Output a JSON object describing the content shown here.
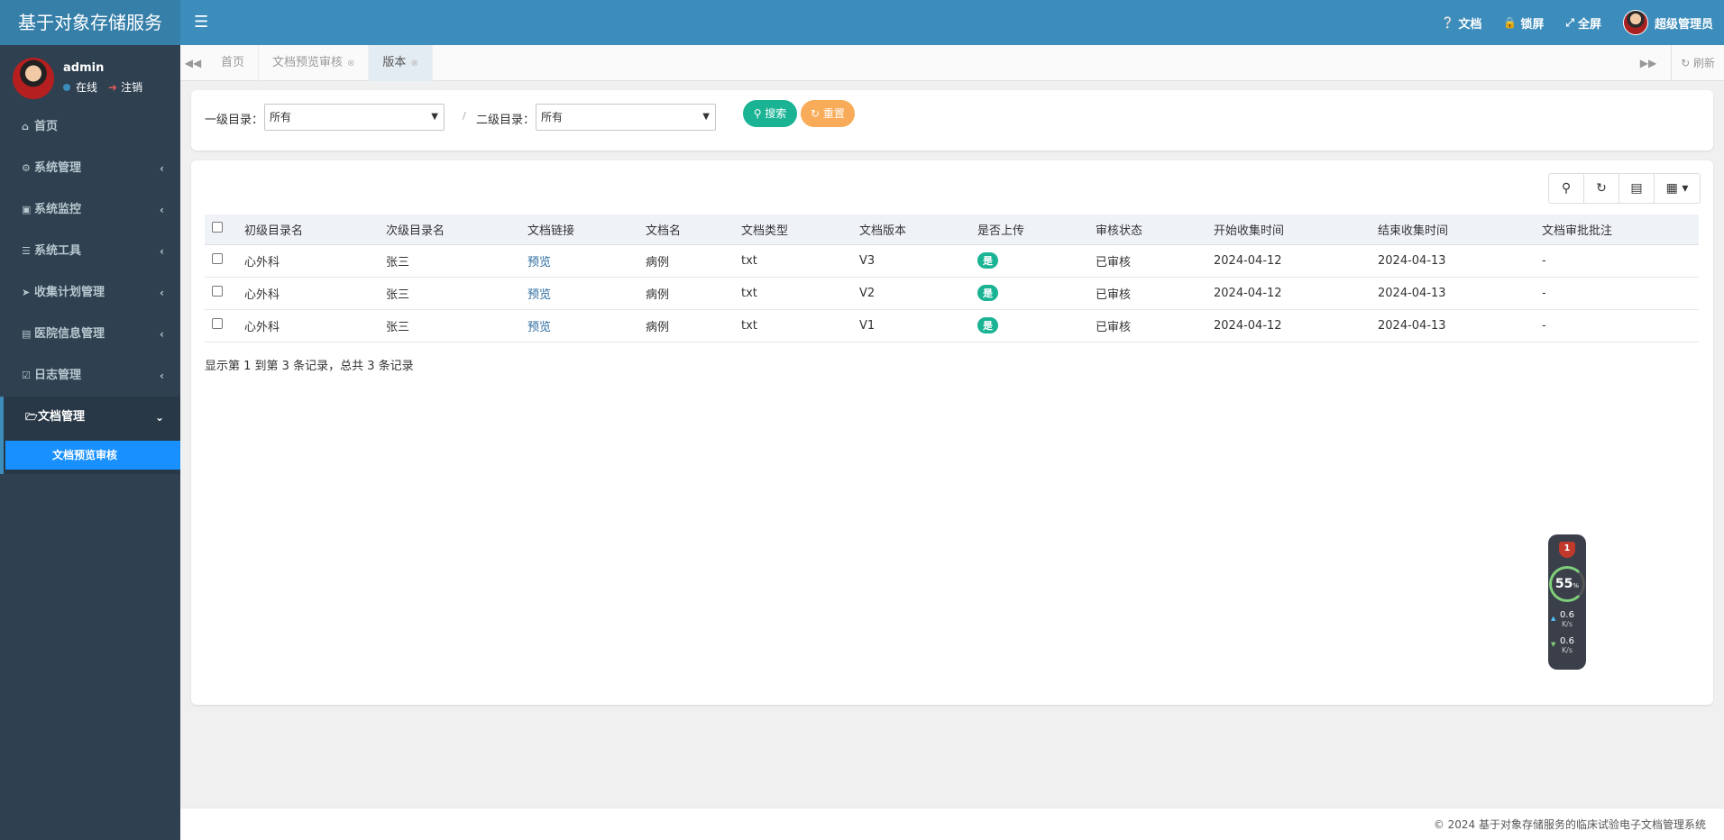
{
  "header": {
    "app_title": "基于对象存储服务",
    "menu_icon": "hamburger-icon",
    "nav": [
      {
        "icon": "question-circle-icon",
        "label": "文档"
      },
      {
        "icon": "lock-icon",
        "label": "锁屏"
      },
      {
        "icon": "fullscreen-icon",
        "label": "全屏"
      }
    ],
    "user_label": "超级管理员"
  },
  "sidebar": {
    "user_name": "admin",
    "status_online": "在线",
    "logout": "注销",
    "items": [
      {
        "icon": "home-icon",
        "label": "首页"
      },
      {
        "icon": "gear-icon",
        "label": "系统管理"
      },
      {
        "icon": "video-icon",
        "label": "系统监控"
      },
      {
        "icon": "bars-icon",
        "label": "系统工具"
      },
      {
        "icon": "paper-plane-icon",
        "label": "收集计划管理"
      },
      {
        "icon": "id-card-icon",
        "label": "医院信息管理"
      },
      {
        "icon": "calendar-check-icon",
        "label": "日志管理"
      },
      {
        "icon": "folder-open-icon",
        "label": "文档管理"
      }
    ],
    "active_subitem": "文档预览审核"
  },
  "tabs": {
    "items": [
      {
        "label": "首页",
        "closable": false
      },
      {
        "label": "文档预览审核",
        "closable": true
      },
      {
        "label": "版本",
        "closable": true
      }
    ],
    "active_index": 2,
    "refresh_label": "刷新"
  },
  "search": {
    "level1_label": "一级目录：",
    "level1_value": "所有",
    "level2_label": "二级目录：",
    "level2_value": "所有",
    "separator": "/",
    "search_button": "搜索",
    "reset_button": "重置",
    "search_color": "#1ab394",
    "reset_color": "#f8ac59"
  },
  "table": {
    "columns": [
      "初级目录名",
      "次级目录名",
      "文档链接",
      "文档名",
      "文档类型",
      "文档版本",
      "是否上传",
      "审核状态",
      "开始收集时间",
      "结束收集时间",
      "文档审批批注"
    ],
    "rows": [
      {
        "c1": "心外科",
        "c2": "张三",
        "link": "预览",
        "name": "病例",
        "type": "txt",
        "version": "V3",
        "uploaded": "是",
        "status": "已审核",
        "start": "2024-04-12",
        "end": "2024-04-13",
        "note": "-"
      },
      {
        "c1": "心外科",
        "c2": "张三",
        "link": "预览",
        "name": "病例",
        "type": "txt",
        "version": "V2",
        "uploaded": "是",
        "status": "已审核",
        "start": "2024-04-12",
        "end": "2024-04-13",
        "note": "-"
      },
      {
        "c1": "心外科",
        "c2": "张三",
        "link": "预览",
        "name": "病例",
        "type": "txt",
        "version": "V1",
        "uploaded": "是",
        "status": "已审核",
        "start": "2024-04-12",
        "end": "2024-04-13",
        "note": "-"
      }
    ],
    "summary": "显示第 1 到第 3 条记录，总共 3 条记录",
    "toolbar": [
      "search-icon",
      "refresh-icon",
      "list-icon",
      "grid-icon"
    ]
  },
  "widget": {
    "alert_count": "1",
    "cpu": "55",
    "pct": "%",
    "upload": "0.6",
    "download": "0.6",
    "unit": "K/s"
  },
  "footer": {
    "text": "© 2024 基于对象存储服务的临床试验电子文档管理系统"
  }
}
